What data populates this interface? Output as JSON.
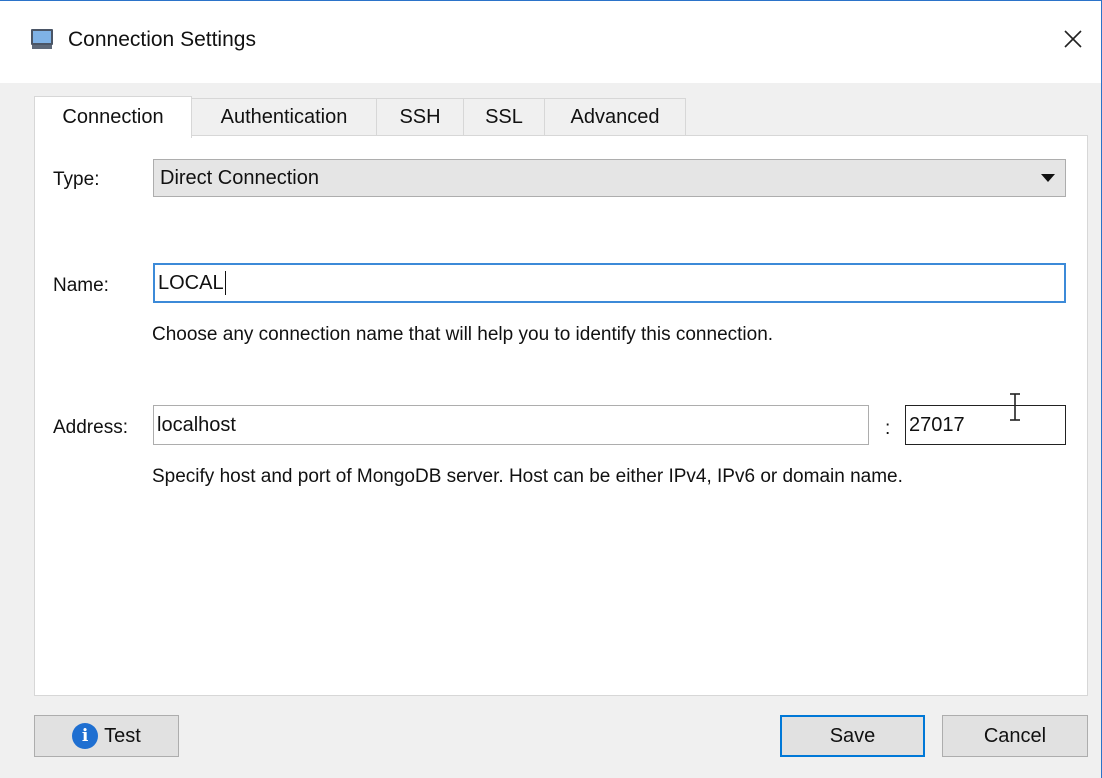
{
  "window": {
    "title": "Connection Settings"
  },
  "tabs": [
    {
      "label": "Connection",
      "active": true
    },
    {
      "label": "Authentication",
      "active": false
    },
    {
      "label": "SSH",
      "active": false
    },
    {
      "label": "SSL",
      "active": false
    },
    {
      "label": "Advanced",
      "active": false
    }
  ],
  "form": {
    "type_label": "Type:",
    "type_value": "Direct Connection",
    "name_label": "Name:",
    "name_value": "LOCAL",
    "name_hint": "Choose any connection name that will help you to identify this connection.",
    "address_label": "Address:",
    "host_value": "localhost",
    "colon": ":",
    "port_value": "27017",
    "address_hint": "Specify host and port of MongoDB server. Host can be either IPv4, IPv6 or domain name."
  },
  "buttons": {
    "test_label": "Test",
    "save_label": "Save",
    "cancel_label": "Cancel"
  },
  "icons": {
    "app": "computer-icon",
    "close": "close-icon",
    "info": "info-icon"
  },
  "colors": {
    "accent": "#0078d7",
    "focus": "#3c8ad8",
    "info": "#1f6fd1"
  }
}
